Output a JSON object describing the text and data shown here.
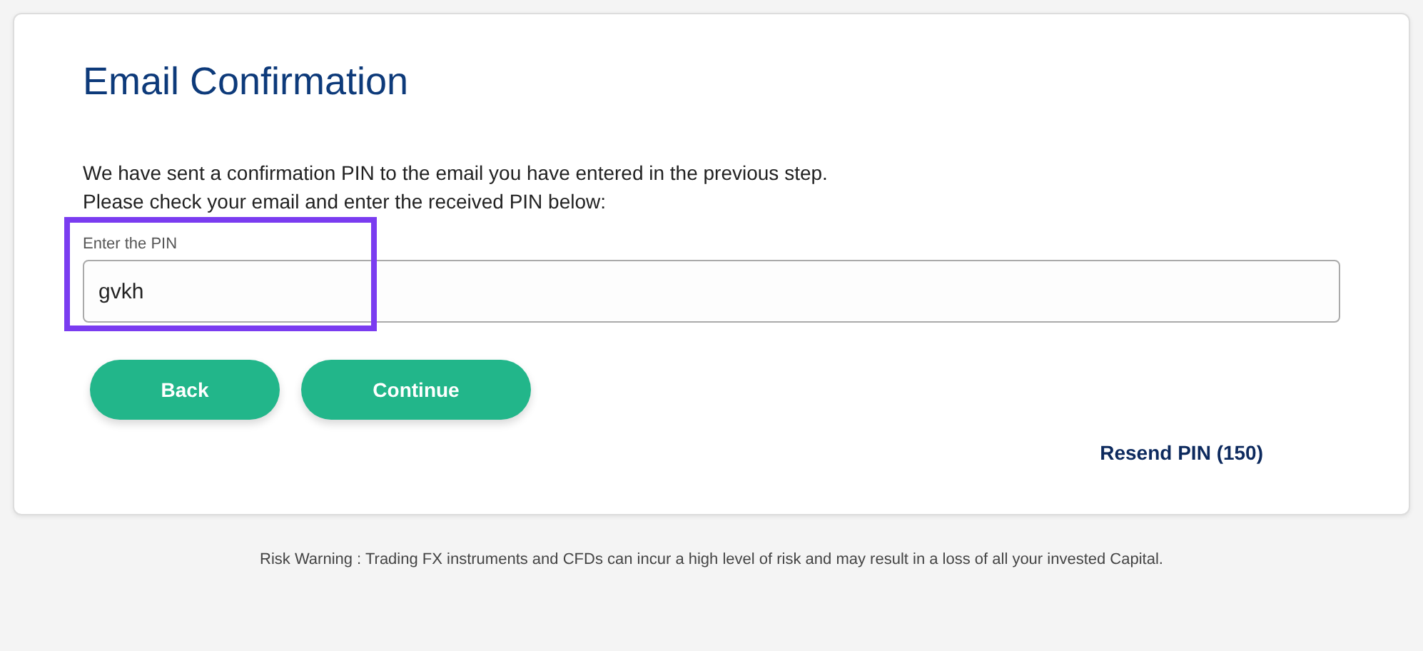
{
  "title": "Email Confirmation",
  "message": [
    "We have sent a confirmation PIN to the email you have entered in the previous step.",
    "Please check your email and enter the received PIN below:"
  ],
  "pin_field": {
    "label": "Enter the PIN",
    "value": "gvkh",
    "highlighted": true
  },
  "buttons": [
    "Back",
    "Continue"
  ],
  "resend_link": "Resend PIN (150)",
  "risk_warning": "Risk Warning : Trading FX instruments and CFDs can incur a high level of risk and may result in a loss of all your invested Capital."
}
